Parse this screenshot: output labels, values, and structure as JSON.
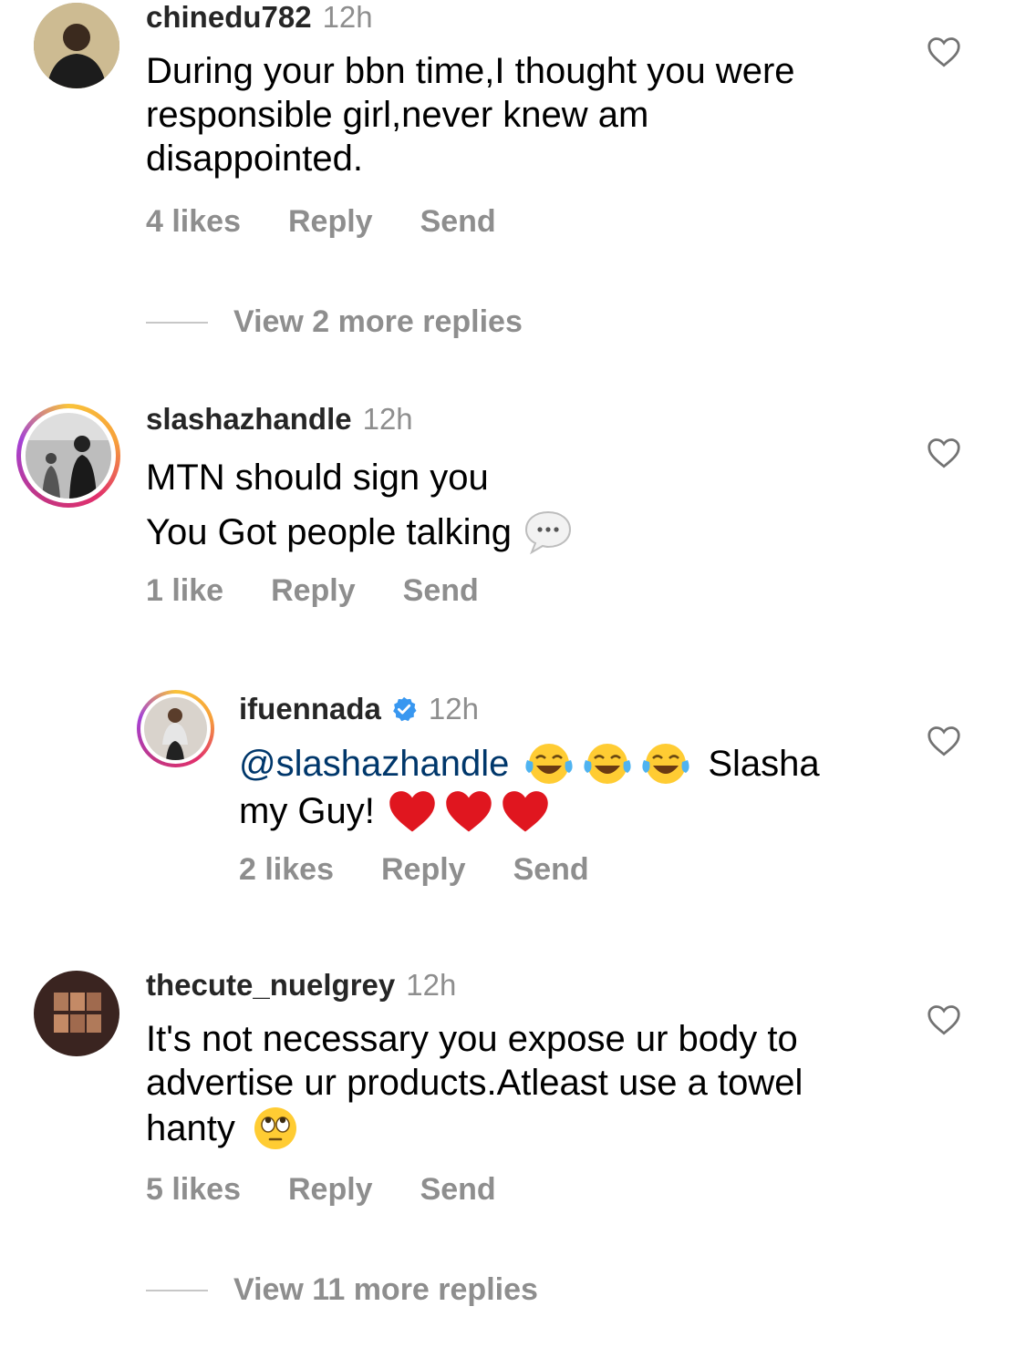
{
  "comments": [
    {
      "username": "chinedu782",
      "time": "12h",
      "lines": [
        "During your bbn time,I thought you were",
        "responsible girl,never knew am",
        "disappointed."
      ],
      "likes": "4 likes",
      "reply": "Reply",
      "send": "Send",
      "view_more": "View 2 more replies"
    },
    {
      "username": "slashazhandle",
      "time": "12h",
      "lines": [
        "MTN should sign you",
        "You Got people talking"
      ],
      "emoji": "speech-bubble",
      "likes": "1 like",
      "reply": "Reply",
      "send": "Send"
    },
    {
      "username": "ifuennada",
      "verified": true,
      "time": "12h",
      "mention": "@slashazhandle",
      "text_after_emoji": "Slasha",
      "line2": "my Guy!",
      "emojis": [
        "face-with-tears-of-joy",
        "face-with-tears-of-joy",
        "face-with-tears-of-joy",
        "red-heart",
        "red-heart",
        "red-heart"
      ],
      "likes": "2 likes",
      "reply": "Reply",
      "send": "Send"
    },
    {
      "username": "thecute_nuelgrey",
      "time": "12h",
      "lines": [
        "It's not necessary you expose ur body to",
        "advertise ur products.Atleast use a towel",
        "hanty"
      ],
      "emoji": "face-with-rolling-eyes",
      "likes": "5 likes",
      "reply": "Reply",
      "send": "Send",
      "view_more": "View 11 more replies"
    }
  ],
  "icons": {
    "heart": "heart-outline-icon",
    "verified": "verified-badge-icon"
  },
  "colors": {
    "username": "#262626",
    "meta": "#8e8e8e",
    "mention": "#00376b",
    "verified": "#3897f0"
  }
}
